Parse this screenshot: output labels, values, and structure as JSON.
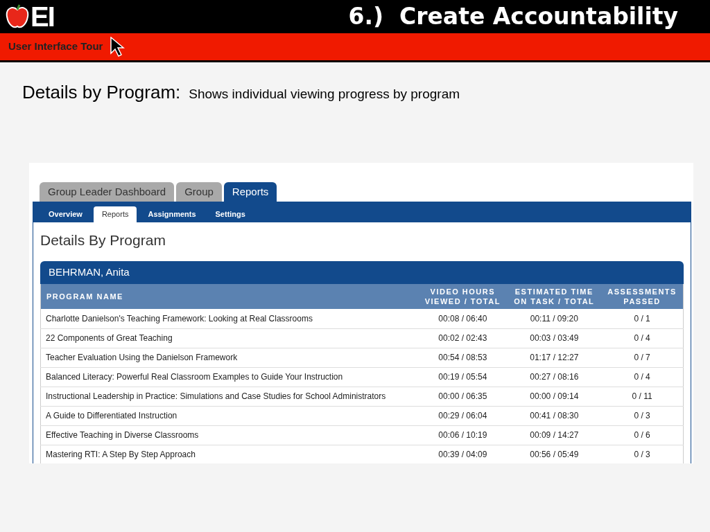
{
  "slide": {
    "logo": "EI",
    "title": "6.)  Create Accountability",
    "banner": "User Interface Tour",
    "heading": "Details by Program:",
    "subheading": "Shows individual viewing progress by program"
  },
  "tabs": [
    {
      "label": "Group Leader Dashboard",
      "selected": false
    },
    {
      "label": "Group",
      "selected": false
    },
    {
      "label": "Reports",
      "selected": true
    }
  ],
  "subtabs": [
    {
      "label": "Overview",
      "selected": false
    },
    {
      "label": "Reports",
      "selected": true
    },
    {
      "label": "Assignments",
      "selected": false
    },
    {
      "label": "Settings",
      "selected": false
    }
  ],
  "page_title": "Details By Program",
  "person": "BEHRMAN, Anita",
  "table": {
    "columns": [
      "PROGRAM NAME",
      "VIDEO HOURS\nVIEWED / TOTAL",
      "ESTIMATED TIME\nON TASK / TOTAL",
      "ASSESSMENTS\nPASSED"
    ],
    "rows": [
      [
        "Charlotte Danielson's Teaching Framework: Looking at Real Classrooms",
        "00:08 / 06:40",
        "00:11 / 09:20",
        "0 / 1"
      ],
      [
        "22 Components of Great Teaching",
        "00:02 / 02:43",
        "00:03 / 03:49",
        "0 / 4"
      ],
      [
        "Teacher Evaluation Using the Danielson Framework",
        "00:54 / 08:53",
        "01:17 / 12:27",
        "0 / 7"
      ],
      [
        "Balanced Literacy: Powerful Real Classroom Examples to Guide Your Instruction",
        "00:19 / 05:54",
        "00:27 / 08:16",
        "0 / 4"
      ],
      [
        "Instructional Leadership in Practice: Simulations and Case Studies for School Administrators",
        "00:00 / 06:35",
        "00:00 / 09:14",
        "0 / 11"
      ],
      [
        "A Guide to Differentiated Instruction",
        "00:29 / 06:04",
        "00:41 / 08:30",
        "0 / 3"
      ],
      [
        "Effective Teaching in Diverse Classrooms",
        "00:06 / 10:19",
        "00:09 / 14:27",
        "0 / 6"
      ],
      [
        "Mastering RTI: A Step By Step Approach",
        "00:39 / 04:09",
        "00:56 / 05:49",
        "0 / 3"
      ]
    ]
  }
}
